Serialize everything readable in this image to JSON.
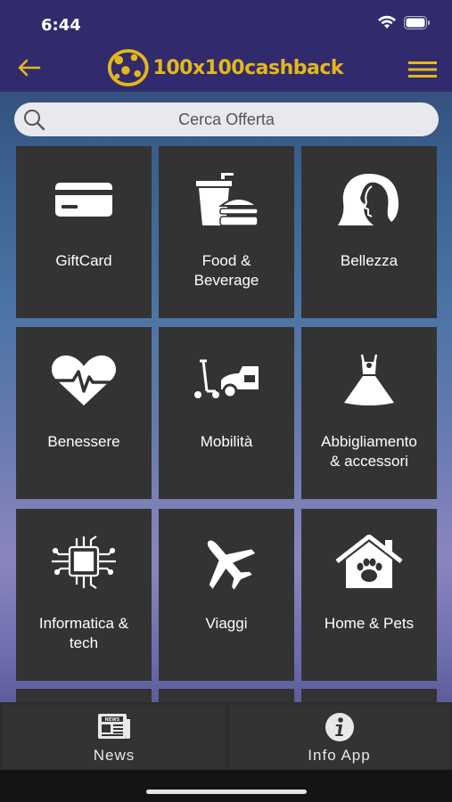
{
  "status": {
    "time": "6:44"
  },
  "header": {
    "logo_text": "100x100cashback",
    "accent": "#e3b918",
    "bg": "#312b6e"
  },
  "search": {
    "placeholder": "Cerca Offerta"
  },
  "categories": [
    {
      "label": "GiftCard",
      "icon": "credit-card-icon"
    },
    {
      "label": "Food &\nBeverage",
      "icon": "fast-food-icon"
    },
    {
      "label": "Bellezza",
      "icon": "woman-profile-icon"
    },
    {
      "label": "Benessere",
      "icon": "heart-pulse-icon"
    },
    {
      "label": "Mobilità",
      "icon": "scooter-car-icon"
    },
    {
      "label": "Abbigliamento\n& accessori",
      "icon": "dress-icon"
    },
    {
      "label": "Informatica &\ntech",
      "icon": "circuit-chip-icon"
    },
    {
      "label": "Viaggi",
      "icon": "airplane-icon"
    },
    {
      "label": "Home & Pets",
      "icon": "house-paw-icon"
    }
  ],
  "tabs": [
    {
      "label": "News",
      "icon": "newspaper-icon"
    },
    {
      "label": "Info App",
      "icon": "info-icon"
    }
  ]
}
